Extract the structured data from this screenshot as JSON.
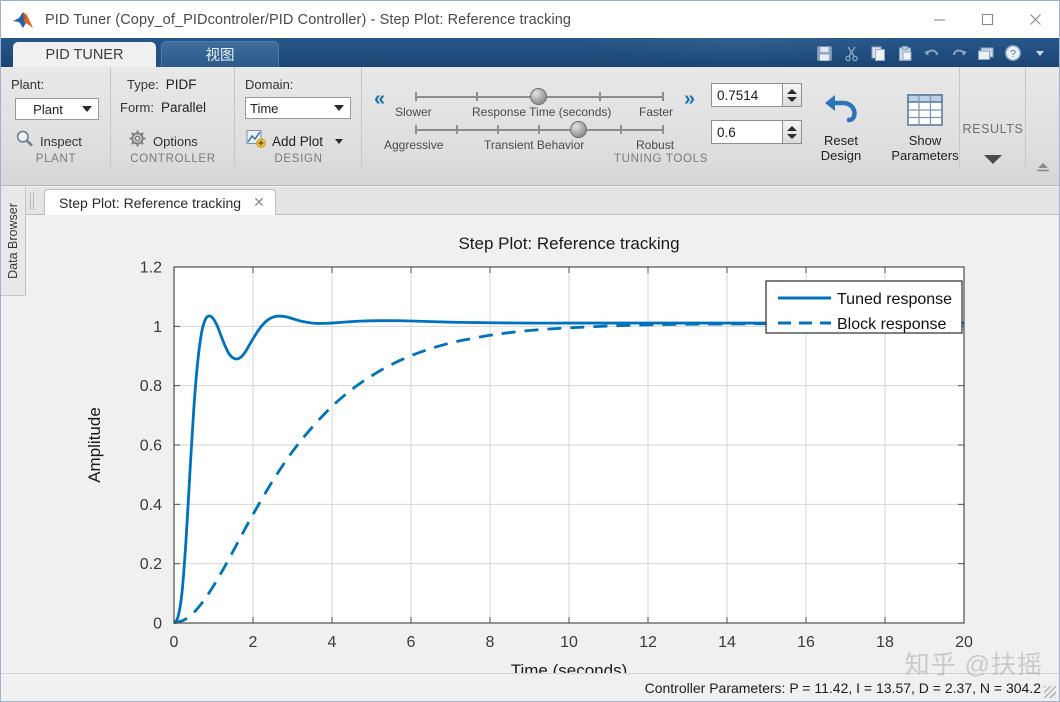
{
  "window": {
    "title": "PID Tuner (Copy_of_PIDcontroler/PID Controller) - Step Plot: Reference tracking",
    "minimize": "─",
    "maximize": "□",
    "close": "✕"
  },
  "ribbon": {
    "tabs": [
      {
        "label": "PID TUNER",
        "active": true
      },
      {
        "label": "视图",
        "active": false
      }
    ],
    "quick_access": [
      "save-icon",
      "cut-icon",
      "copy-icon",
      "paste-icon",
      "undo-icon",
      "redo-icon",
      "layout-icon",
      "help-icon",
      "more-icon"
    ],
    "groups": {
      "plant": {
        "title": "PLANT",
        "label": "Plant:",
        "combo_value": "Plant",
        "inspect": "Inspect"
      },
      "controller": {
        "title": "CONTROLLER",
        "type_label": "Type:",
        "type_value": "PIDF",
        "form_label": "Form:",
        "form_value": "Parallel",
        "options": "Options"
      },
      "design": {
        "title": "DESIGN",
        "domain_label": "Domain:",
        "domain_value": "Time",
        "add_plot": "Add Plot"
      },
      "tuning": {
        "title": "TUNING TOOLS",
        "slider1": {
          "name": "Response Time (seconds)",
          "left": "Slower",
          "right": "Faster",
          "value": "0.7514"
        },
        "slider2": {
          "name": "Transient Behavior",
          "left": "Aggressive",
          "right": "Robust",
          "value": "0.6"
        },
        "prev": "«",
        "next": "»",
        "reset_design": "Reset\nDesign",
        "reset_design_line1": "Reset",
        "reset_design_line2": "Design",
        "show_parameters_line1": "Show",
        "show_parameters_line2": "Parameters"
      },
      "results": {
        "title": "RESULTS"
      }
    }
  },
  "sidebar": {
    "data_browser": "Data Browser"
  },
  "document": {
    "tab_label": "Step Plot: Reference tracking",
    "close": "✕"
  },
  "status": {
    "controller_parameters": "Controller Parameters: P = 11.42, I = 13.57, D = 2.37, N = 304.2"
  },
  "watermark": {
    "text": "知乎 @扶摇"
  },
  "chart_data": {
    "type": "line",
    "title": "Step Plot: Reference tracking",
    "xlabel": "Time (seconds)",
    "ylabel": "Amplitude",
    "xlim": [
      0,
      20
    ],
    "ylim": [
      0,
      1.2
    ],
    "xticks": [
      0,
      2,
      4,
      6,
      8,
      10,
      12,
      14,
      16,
      18,
      20
    ],
    "yticks": [
      0,
      0.2,
      0.4,
      0.6,
      0.8,
      1,
      1.2
    ],
    "grid": true,
    "legend_position": "top-right",
    "line_color": "#0072bd",
    "series": [
      {
        "name": "Tuned response",
        "style": "solid",
        "x": [
          0,
          0.1,
          0.2,
          0.3,
          0.4,
          0.5,
          0.6,
          0.7,
          0.8,
          0.9,
          1.0,
          1.1,
          1.2,
          1.3,
          1.4,
          1.5,
          1.6,
          1.7,
          1.8,
          1.9,
          2.0,
          2.2,
          2.4,
          2.6,
          2.8,
          3.0,
          3.2,
          3.4,
          3.6,
          3.8,
          4.0,
          4.4,
          4.8,
          5.2,
          5.6,
          6.0,
          6.5,
          7.0,
          7.5,
          8.0,
          9.0,
          10.0,
          12.0,
          14.0,
          16.0,
          18.0,
          20.0
        ],
        "y": [
          0.0,
          0.02,
          0.1,
          0.27,
          0.5,
          0.72,
          0.88,
          0.98,
          1.025,
          1.035,
          1.025,
          1.0,
          0.965,
          0.932,
          0.906,
          0.893,
          0.89,
          0.897,
          0.913,
          0.935,
          0.958,
          0.998,
          1.024,
          1.034,
          1.033,
          1.026,
          1.018,
          1.013,
          1.01,
          1.01,
          1.011,
          1.015,
          1.018,
          1.019,
          1.019,
          1.018,
          1.016,
          1.014,
          1.013,
          1.012,
          1.011,
          1.011,
          1.011,
          1.011,
          1.011,
          1.011,
          1.011
        ]
      },
      {
        "name": "Block response",
        "style": "dashed",
        "x": [
          0,
          0.25,
          0.5,
          0.75,
          1.0,
          1.25,
          1.5,
          1.75,
          2.0,
          2.5,
          3.0,
          3.5,
          4.0,
          4.5,
          5.0,
          5.5,
          6.0,
          6.5,
          7.0,
          7.5,
          8.0,
          8.5,
          9.0,
          9.5,
          10.0,
          11.0,
          12.0,
          13.0,
          14.0,
          15.0,
          16.0,
          17.0,
          18.0,
          19.0,
          20.0
        ],
        "y": [
          0.0,
          0.01,
          0.035,
          0.075,
          0.125,
          0.182,
          0.243,
          0.305,
          0.366,
          0.479,
          0.578,
          0.66,
          0.73,
          0.787,
          0.833,
          0.871,
          0.901,
          0.925,
          0.944,
          0.958,
          0.97,
          0.979,
          0.986,
          0.991,
          0.995,
          1.001,
          1.005,
          1.007,
          1.008,
          1.009,
          1.01,
          1.01,
          1.011,
          1.011,
          1.011
        ]
      }
    ]
  }
}
